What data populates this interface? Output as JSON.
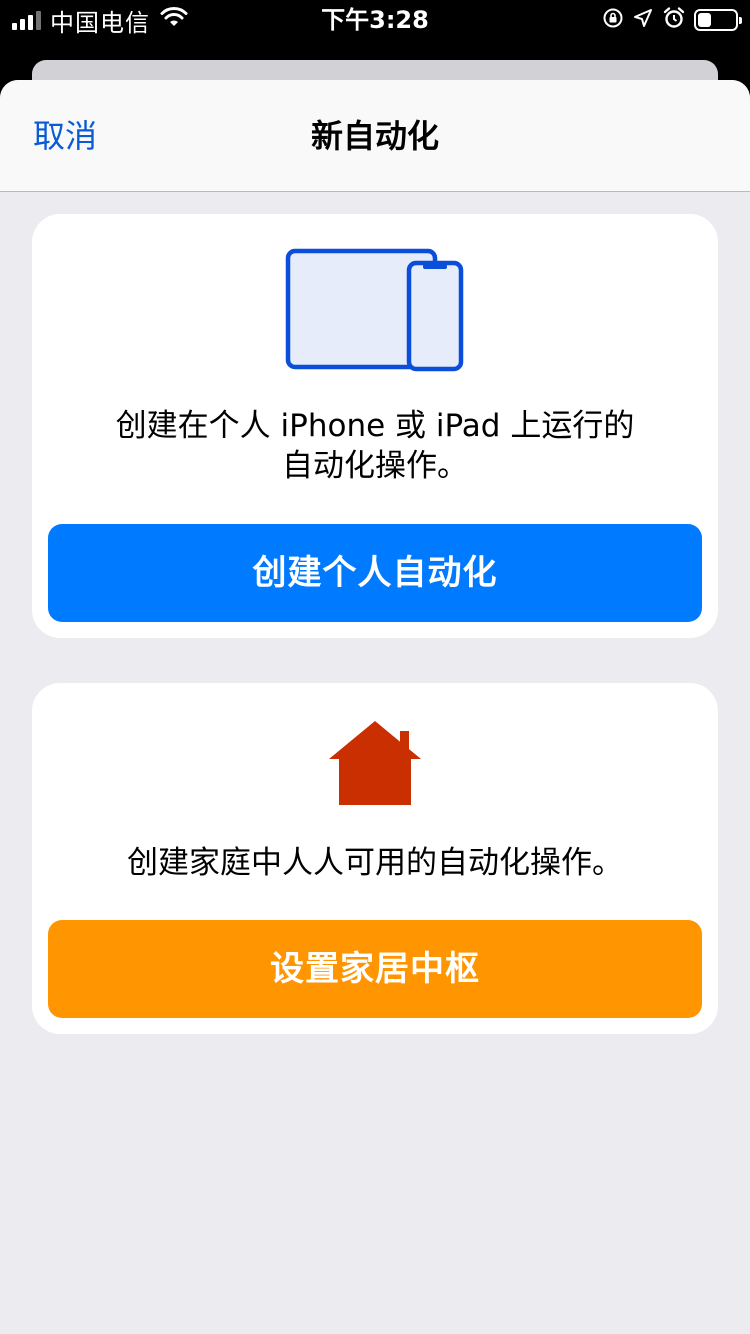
{
  "status_bar": {
    "carrier": "中国电信",
    "time": "下午3:28",
    "battery_level": 0.35
  },
  "nav": {
    "cancel_label": "取消",
    "title": "新自动化"
  },
  "personal_card": {
    "icon": "iphone-ipad-icon",
    "description_line1": "创建在个人 iPhone 或 iPad 上运行的",
    "description_line2": "自动化操作。",
    "button_label": "创建个人自动化"
  },
  "home_card": {
    "icon": "house-icon",
    "description": "创建家庭中人人可用的自动化操作。",
    "button_label": "设置家居中枢"
  },
  "colors": {
    "accent_blue": "#007aff",
    "accent_orange": "#ff9500",
    "home_icon_red": "#c92f00",
    "device_icon_blue": "#0b4ed9"
  }
}
